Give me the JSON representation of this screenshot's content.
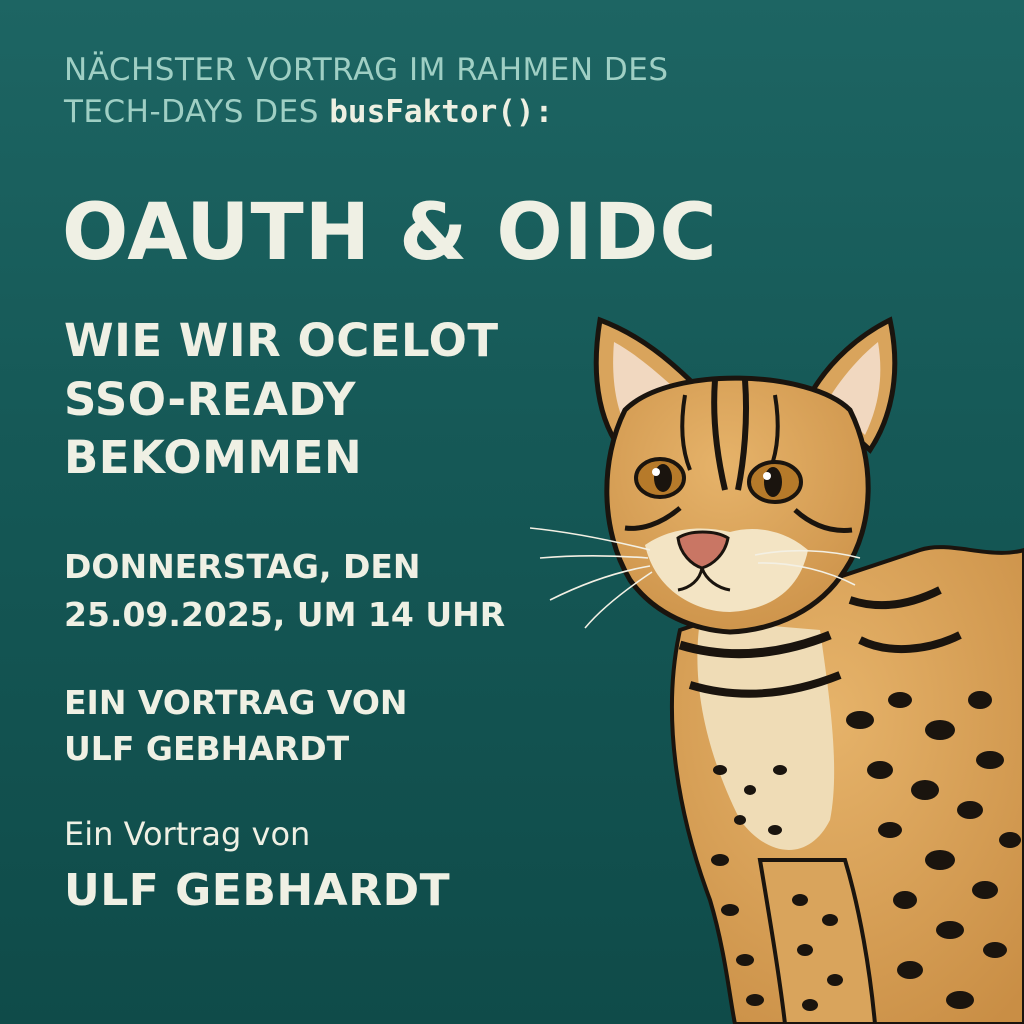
{
  "intro": {
    "line1": "NÄCHSTER VORTRAG IM RAHMEN DES",
    "line2_prefix": "TECH-DAYS DES",
    "brand": "busFaktor():"
  },
  "title": "OAUTH & OIDC",
  "subtitle": {
    "lines": [
      "WIE WIR OCELOT",
      "SSO-READY",
      "BEKOMMEN"
    ]
  },
  "date": {
    "line1": "DONNERSTAG, DEN",
    "line2": "25.09.2025, UM 14 UHR"
  },
  "speaker_upper": {
    "line1": "EIN VORTRAG VON",
    "line2": "ULF GEBHARDT"
  },
  "speaker": {
    "intro": "Ein Vortrag von",
    "name": "ULF GEBHARDT"
  },
  "illustration": {
    "icon": "ocelot-icon"
  },
  "colors": {
    "background_top": "#1d6563",
    "background_bottom": "#0f4b49",
    "intro_text": "#9fcfc4",
    "main_text": "#eff0e4",
    "fur": "#d9a45c",
    "spots": "#1a140e"
  }
}
